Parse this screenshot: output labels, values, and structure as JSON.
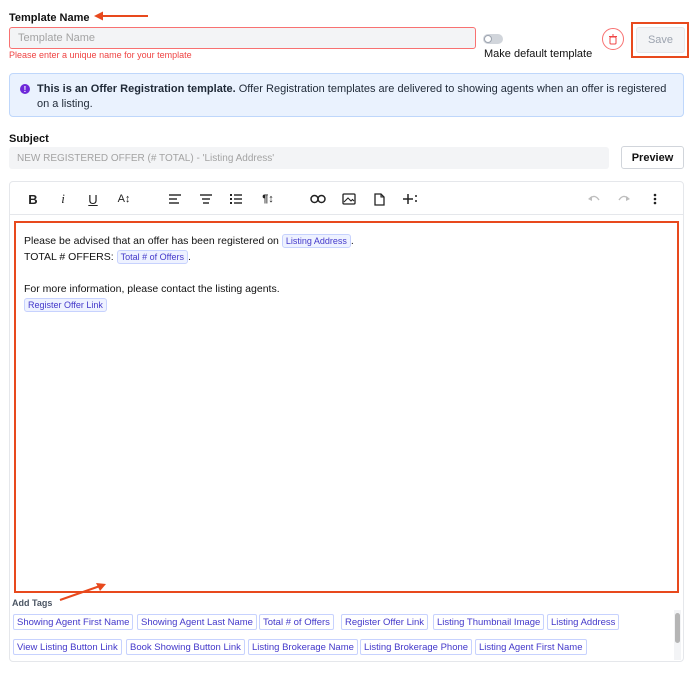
{
  "template_name": {
    "label": "Template Name",
    "placeholder": "Template Name",
    "error": "Please enter a unique name for your template"
  },
  "default_toggle": {
    "label": "Make default template",
    "checked": false
  },
  "save_label": "Save",
  "info_banner": {
    "bold": "This is an Offer Registration template.",
    "text": " Offer Registration templates are delivered to showing agents when an offer is registered on a listing."
  },
  "subject": {
    "label": "Subject",
    "value": "NEW REGISTERED OFFER (# TOTAL) - 'Listing Address'"
  },
  "preview_label": "Preview",
  "toolbar": {
    "bold": "B",
    "italic": "i",
    "underline": "U",
    "font_size": "A↕",
    "paragraph": "¶↕"
  },
  "body": {
    "line1_text": "Please be advised that an offer has been registered on ",
    "line1_tag": "Listing Address",
    "line1_end": ".",
    "line2_text": "TOTAL # OFFERS: ",
    "line2_tag": "Total # of Offers",
    "line2_end": ".",
    "line4_text": "For more information, please contact the listing agents.",
    "line5_tag": "Register Offer Link"
  },
  "add_tags": {
    "label": "Add Tags",
    "tags": [
      "Showing Agent First Name",
      "Showing Agent Last Name",
      "Total # of Offers",
      "Register Offer Link",
      "Listing Thumbnail Image",
      "Listing Address",
      "View Listing Button Link",
      "Book Showing Button Link",
      "Listing Brokerage Name",
      "Listing Brokerage Phone",
      "Listing Agent First Name"
    ]
  },
  "colors": {
    "accent_red": "#e8491d",
    "tag_purple": "#4338ca",
    "error_red": "#ef4444",
    "banner_bg": "#eaf2fe"
  }
}
